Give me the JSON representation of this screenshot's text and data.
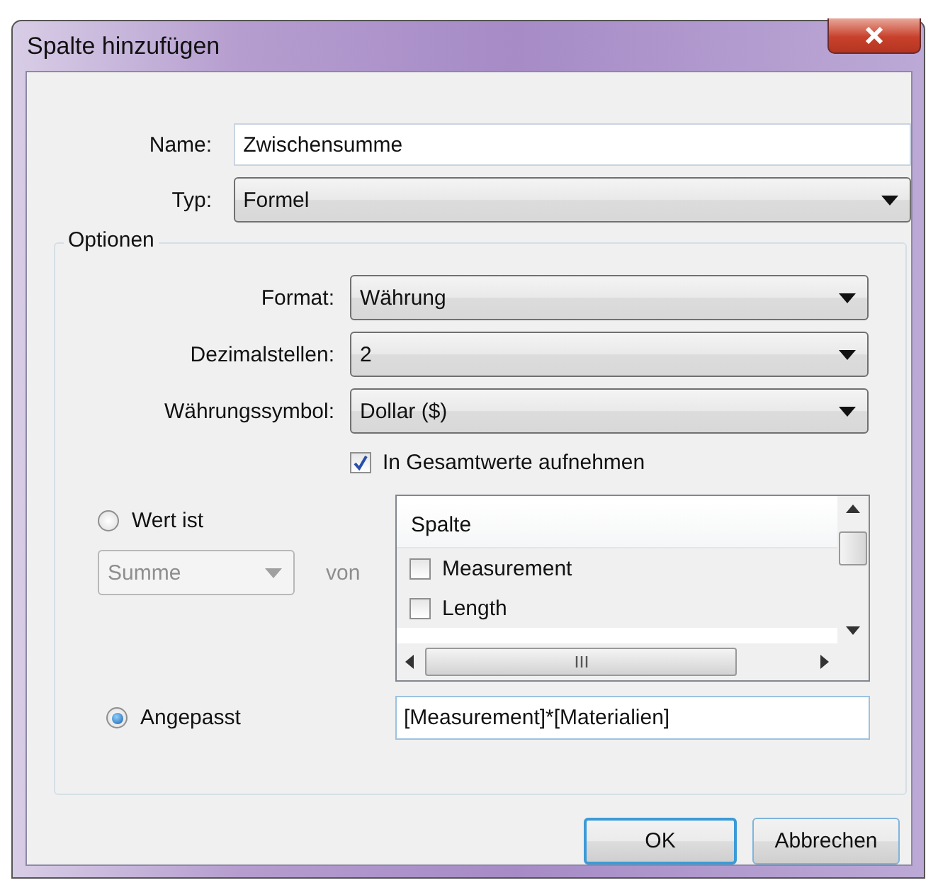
{
  "window": {
    "title": "Spalte hinzufügen"
  },
  "name_field": {
    "label": "Name:",
    "value": "Zwischensumme"
  },
  "type_field": {
    "label": "Typ:",
    "value": "Formel"
  },
  "options": {
    "title": "Optionen",
    "dropdowns": [
      {
        "label": "Format:",
        "value": "Währung"
      },
      {
        "label": "Dezimalstellen:",
        "value": "2"
      },
      {
        "label": "Währungssymbol:",
        "value": "Dollar ($)"
      }
    ],
    "include_totals": {
      "label": "In Gesamtwerte aufnehmen",
      "checked": true
    },
    "value_mode": {
      "label": "Wert ist",
      "selected": false
    },
    "aggregate": {
      "value": "Summe",
      "disabled": true
    },
    "of_label": "von",
    "column_list": {
      "header": "Spalte",
      "items": [
        {
          "label": "Measurement",
          "checked": false
        },
        {
          "label": "Length",
          "checked": false
        }
      ]
    },
    "custom_mode": {
      "label": "Angepasst",
      "selected": true
    },
    "formula": {
      "value": "[Measurement]*[Materialien]"
    }
  },
  "buttons": [
    {
      "label": "OK",
      "default": true
    },
    {
      "label": "Abbrechen",
      "default": false
    }
  ]
}
